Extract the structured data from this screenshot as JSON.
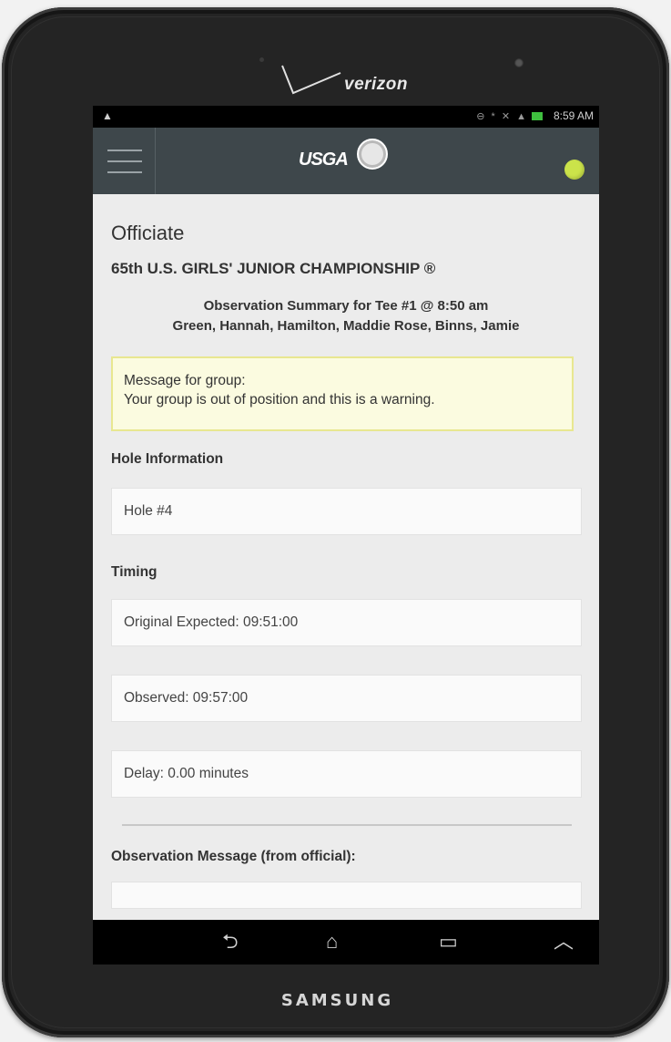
{
  "device": {
    "carrier": "verizon",
    "brand": "SAMSUNG"
  },
  "status_bar": {
    "warning_icon": "warning-icon",
    "icons": "⊖ * ✕ ▲",
    "battery": "91%",
    "time": "8:59 AM"
  },
  "app_bar": {
    "menu_icon": "hamburger-icon",
    "logo_text": "USGA",
    "status_color": "#cbe34a"
  },
  "page": {
    "title": "Officiate",
    "event": "65th U.S. GIRLS' JUNIOR CHAMPIONSHIP ®",
    "observation_summary": "Observation Summary for Tee #1 @ 8:50 am",
    "players": "Green, Hannah, Hamilton, Maddie Rose, Binns, Jamie"
  },
  "message": {
    "label": "Message for group:",
    "text": "Your group is out of position and this is a warning."
  },
  "hole_information": {
    "label": "Hole Information",
    "value": "Hole #4"
  },
  "timing": {
    "label": "Timing",
    "original_expected": "Original Expected: 09:51:00",
    "observed": "Observed: 09:57:00",
    "delay": "Delay: 0.00 minutes"
  },
  "observation_message": {
    "label": "Observation Message (from official):",
    "value": ""
  },
  "nav": {
    "back": "back-icon",
    "home": "home-icon",
    "recents": "recents-icon",
    "up": "chevron-up-icon"
  }
}
